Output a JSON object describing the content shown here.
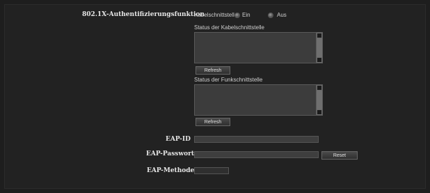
{
  "auth": {
    "label": "802.1X-Authentifizierungsfunktion",
    "wired_label": "Kabelschnittstelle",
    "on_label": "Ein",
    "off_label": "Aus"
  },
  "wired_status": {
    "label": "Status der Kabelschnittstelle",
    "refresh_label": "Refresh"
  },
  "wireless_status": {
    "label": "Status der Funkschnittstelle",
    "refresh_label": "Refresh"
  },
  "eap": {
    "id_label": "EAP-ID",
    "password_label": "EAP-Passwort",
    "reset_label": "Reset",
    "method_label": "EAP-Methode"
  }
}
